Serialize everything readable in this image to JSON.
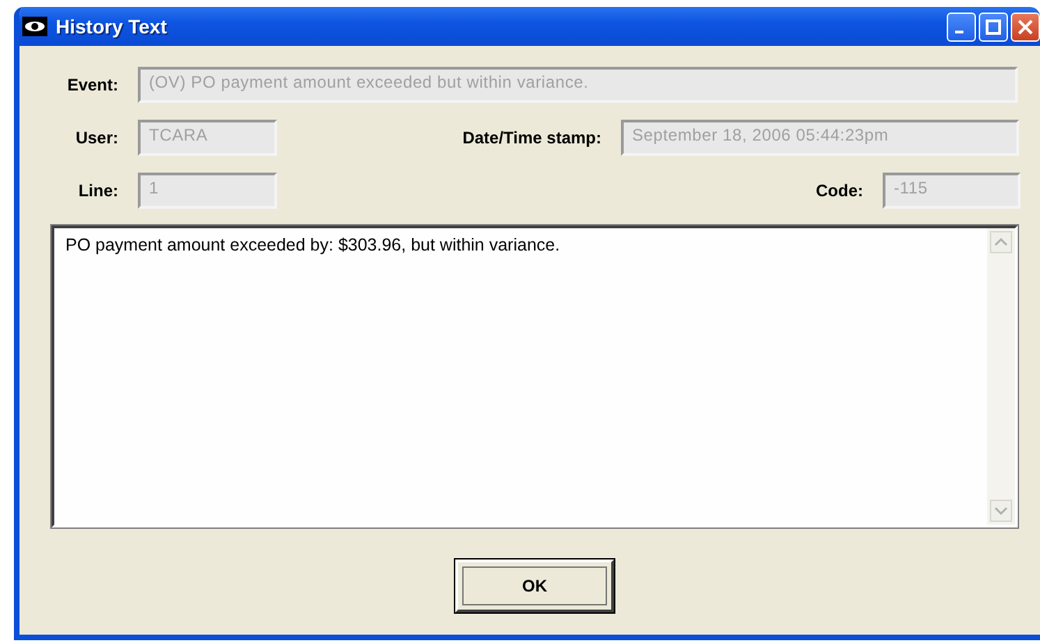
{
  "window": {
    "title": "History Text"
  },
  "fields": [
    {
      "label": "Event:",
      "value": "(OV) PO payment amount exceeded but within variance.",
      "disabled": true
    },
    {
      "label": "User:",
      "value": "TCARA",
      "disabled": true
    },
    {
      "label": "Date/Time stamp:",
      "value": "September 18, 2006 05:44:23pm",
      "disabled": true
    },
    {
      "label": "Line:",
      "value": "1",
      "disabled": true
    },
    {
      "label": "Code:",
      "value": "-115",
      "disabled": true
    }
  ],
  "history_text": "PO payment amount exceeded by: $303.96, but within variance.",
  "buttons": [
    {
      "label": "OK",
      "focused": true
    }
  ]
}
